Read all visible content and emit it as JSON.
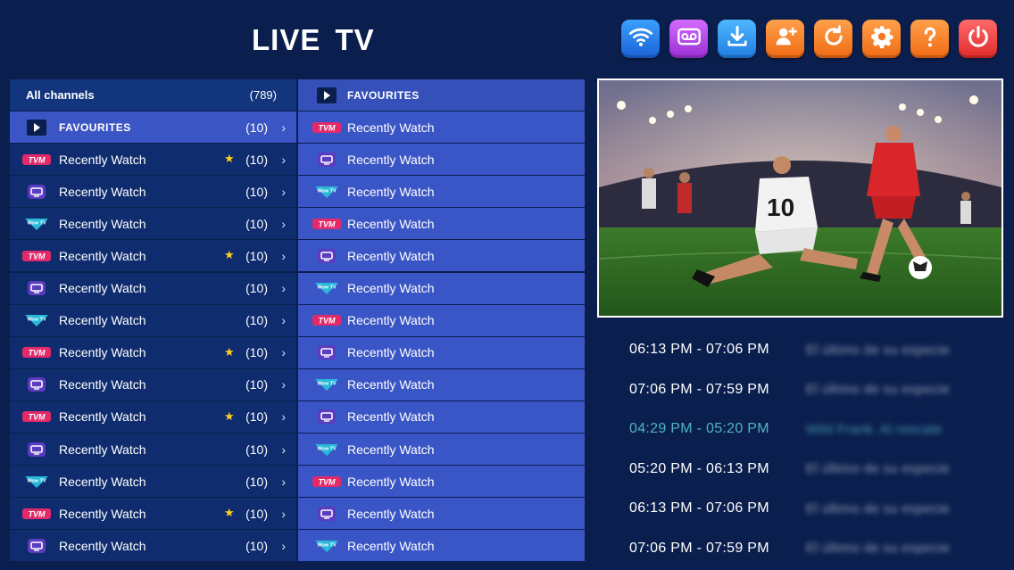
{
  "header": {
    "title": "LIVE  TV"
  },
  "toolbar": [
    {
      "name": "wifi-icon",
      "color": "blue"
    },
    {
      "name": "voicemail-icon",
      "color": "purple"
    },
    {
      "name": "download-icon",
      "color": "lblue"
    },
    {
      "name": "add-user-icon",
      "color": "orange"
    },
    {
      "name": "refresh-icon",
      "color": "orange"
    },
    {
      "name": "gear-icon",
      "color": "orange"
    },
    {
      "name": "help-icon",
      "color": "orange"
    },
    {
      "name": "power-icon",
      "color": "red"
    }
  ],
  "categories": {
    "header": {
      "label": "All channels",
      "count": "(789)"
    },
    "items": [
      {
        "label": "FAVOURITES",
        "count": "(10)",
        "logo": "play",
        "active": true,
        "star": false
      },
      {
        "label": "Recently Watch",
        "count": "(10)",
        "logo": "tvm",
        "star": true
      },
      {
        "label": "Recently Watch",
        "count": "(10)",
        "logo": "tv",
        "star": false
      },
      {
        "label": "Recently Watch",
        "count": "(10)",
        "logo": "wow",
        "star": false
      },
      {
        "label": "Recently Watch",
        "count": "(10)",
        "logo": "tvm",
        "star": true
      },
      {
        "label": "Recently Watch",
        "count": "(10)",
        "logo": "tv",
        "star": false
      },
      {
        "label": "Recently Watch",
        "count": "(10)",
        "logo": "wow",
        "star": false
      },
      {
        "label": "Recently Watch",
        "count": "(10)",
        "logo": "tvm",
        "star": true
      },
      {
        "label": "Recently Watch",
        "count": "(10)",
        "logo": "tv",
        "star": false
      },
      {
        "label": "Recently Watch",
        "count": "(10)",
        "logo": "tvm",
        "star": true
      },
      {
        "label": "Recently Watch",
        "count": "(10)",
        "logo": "tv",
        "star": false
      },
      {
        "label": "Recently Watch",
        "count": "(10)",
        "logo": "wow",
        "star": false
      },
      {
        "label": "Recently Watch",
        "count": "(10)",
        "logo": "tvm",
        "star": true
      },
      {
        "label": "Recently Watch",
        "count": "(10)",
        "logo": "tv",
        "star": false
      }
    ]
  },
  "channels": {
    "header": {
      "label": "FAVOURITES",
      "logo": "play"
    },
    "items": [
      {
        "label": "Recently Watch",
        "logo": "tvm"
      },
      {
        "label": "Recently Watch",
        "logo": "tv"
      },
      {
        "label": "Recently Watch",
        "logo": "wow"
      },
      {
        "label": "Recently Watch",
        "logo": "tvm"
      },
      {
        "label": "Recently Watch",
        "logo": "tv"
      },
      {
        "label": "Recently Watch",
        "logo": "wow"
      },
      {
        "label": "Recently Watch",
        "logo": "tvm"
      },
      {
        "label": "Recently Watch",
        "logo": "tv"
      },
      {
        "label": "Recently Watch",
        "logo": "wow"
      },
      {
        "label": "Recently Watch",
        "logo": "tv"
      },
      {
        "label": "Recently Watch",
        "logo": "wow"
      },
      {
        "label": "Recently Watch",
        "logo": "tvm"
      },
      {
        "label": "Recently Watch",
        "logo": "tv"
      },
      {
        "label": "Recently Watch",
        "logo": "wow"
      }
    ]
  },
  "epg": [
    {
      "time": "06:13 PM - 07:06 PM",
      "program": "El último de su especie",
      "current": false
    },
    {
      "time": "07:06 PM - 07:59 PM",
      "program": "El último de su especie",
      "current": false
    },
    {
      "time": "04:29 PM - 05:20 PM",
      "program": "Wild Frank. Al rescate",
      "current": true
    },
    {
      "time": "05:20 PM - 06:13 PM",
      "program": "El último de su especie",
      "current": false
    },
    {
      "time": "06:13 PM - 07:06 PM",
      "program": "El último de su especie",
      "current": false
    },
    {
      "time": "07:06 PM - 07:59 PM",
      "program": "El último de su especie",
      "current": false
    }
  ],
  "logo_texts": {
    "tvm": "TVM",
    "wow": "Wow TV",
    "tv": ""
  },
  "colors": {
    "background": "#0b1f4e",
    "active_row": "#3b56c4",
    "channel_row": "#3a56c6",
    "star": "#ffd21a",
    "current_epg": "#4fb3c6"
  }
}
